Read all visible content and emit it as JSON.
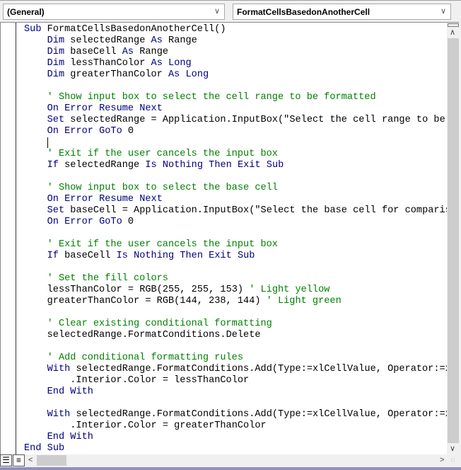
{
  "object_dropdown": {
    "value": "(General)"
  },
  "procedure_dropdown": {
    "value": "FormatCellsBasedonAnotherCell"
  },
  "colors": {
    "keyword": "#00007f",
    "comment": "#008000",
    "text": "#000000"
  },
  "icons": {
    "dropdown": "chevron-down-icon",
    "procedure_view": "procedure-view-icon",
    "module_view": "full-module-view-icon"
  },
  "code_lines": [
    "Sub FormatCellsBasedonAnotherCell()",
    "    Dim selectedRange As Range",
    "    Dim baseCell As Range",
    "    Dim lessThanColor As Long",
    "    Dim greaterThanColor As Long",
    "",
    "    ' Show input box to select the cell range to be formatted",
    "    On Error Resume Next",
    "    Set selectedRange = Application.InputBox(\"Select the cell range to be f",
    "    On Error GoTo 0",
    "",
    "    ' Exit if the user cancels the input box",
    "    If selectedRange Is Nothing Then Exit Sub",
    "",
    "    ' Show input box to select the base cell",
    "    On Error Resume Next",
    "    Set baseCell = Application.InputBox(\"Select the base cell for compariso",
    "    On Error GoTo 0",
    "",
    "    ' Exit if the user cancels the input box",
    "    If baseCell Is Nothing Then Exit Sub",
    "",
    "    ' Set the fill colors",
    "    lessThanColor = RGB(255, 255, 153) ' Light yellow",
    "    greaterThanColor = RGB(144, 238, 144) ' Light green",
    "",
    "    ' Clear existing conditional formatting",
    "    selectedRange.FormatConditions.Delete",
    "",
    "    ' Add conditional formatting rules",
    "    With selectedRange.FormatConditions.Add(Type:=xlCellValue, Operator:=xl",
    "        .Interior.Color = lessThanColor",
    "    End With",
    "",
    "    With selectedRange.FormatConditions.Add(Type:=xlCellValue, Operator:=xl",
    "        .Interior.Color = greaterThanColor",
    "    End With",
    "End Sub"
  ]
}
